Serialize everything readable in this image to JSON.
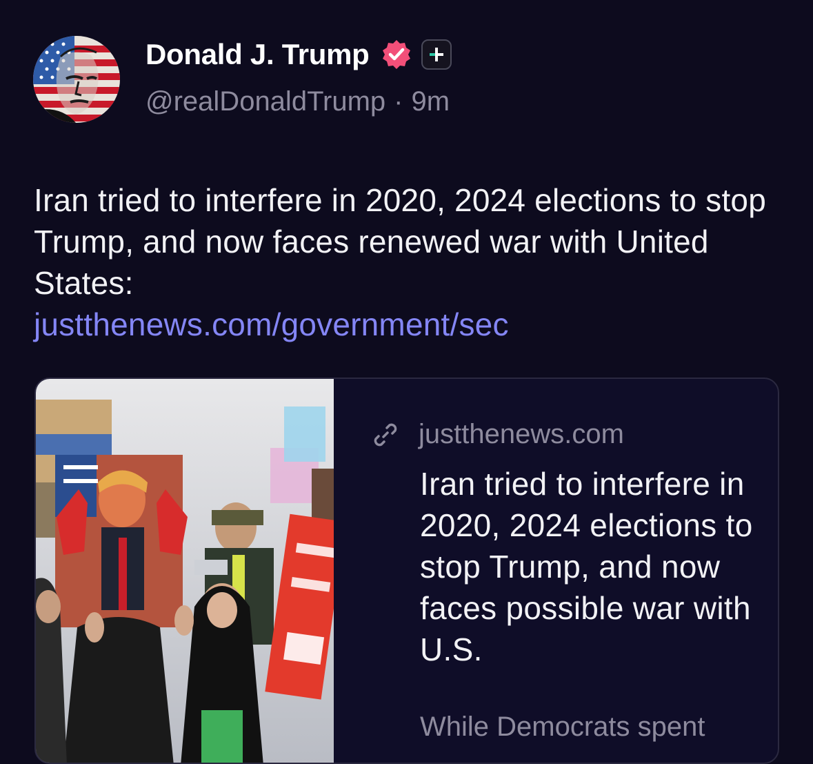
{
  "post": {
    "author": {
      "display_name": "Donald J. Trump",
      "handle": "@realDonaldTrump",
      "time_separator": "·",
      "timestamp": "9m",
      "verified_icon": "verified-badge-icon",
      "extra_badge_icon": "plus-badge-icon"
    },
    "text": "Iran tried to interfere in 2020, 2024 elections to stop Trump, and now faces renewed war with United States:",
    "link": "justthenews.com/government/sec"
  },
  "card": {
    "domain_icon": "link-icon",
    "domain": "justthenews.com",
    "title": "Iran tried to interfere in 2020, 2024 elections to stop Trump, and now faces possible war with U.S.",
    "snippet": "While Democrats spent"
  },
  "colors": {
    "background": "#0d0b1e",
    "card_background": "#0f0d28",
    "link": "#8486f5",
    "muted_text": "#8e8b9e",
    "verified": "#f24f79",
    "plus_accent": "#2ec8a6"
  }
}
